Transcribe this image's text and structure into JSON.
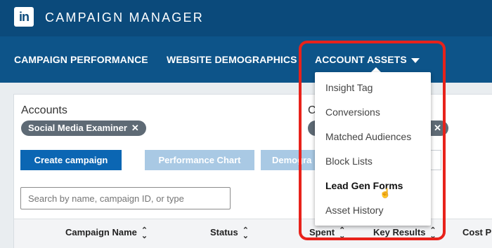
{
  "header": {
    "logo_text": "in",
    "title": "CAMPAIGN MANAGER"
  },
  "nav": {
    "items": [
      {
        "label": "CAMPAIGN PERFORMANCE"
      },
      {
        "label": "WEBSITE DEMOGRAPHICS"
      },
      {
        "label": "ACCOUNT ASSETS"
      }
    ]
  },
  "filters": {
    "accounts_label": "Accounts",
    "second_label": "C",
    "account_chip": "Social Media Examiner",
    "chip_remove": "✕"
  },
  "toolbar": {
    "create_label": "Create campaign",
    "performance_label": "Performance Chart",
    "demographics_label": "Demogra"
  },
  "search": {
    "placeholder": "Search by name, campaign ID, or type"
  },
  "table": {
    "headers": [
      "Campaign Name",
      "Status",
      "Spent",
      "Key Results",
      "Cost P"
    ]
  },
  "menu": {
    "items": [
      "Insight Tag",
      "Conversions",
      "Matched Audiences",
      "Block Lists",
      "Lead Gen Forms",
      "Asset History"
    ],
    "active": "Lead Gen Forms"
  },
  "colors": {
    "header_bg": "#0b4a7b",
    "nav_bg": "#0d5489",
    "primary": "#0b66b3",
    "highlight": "#e8221b"
  }
}
